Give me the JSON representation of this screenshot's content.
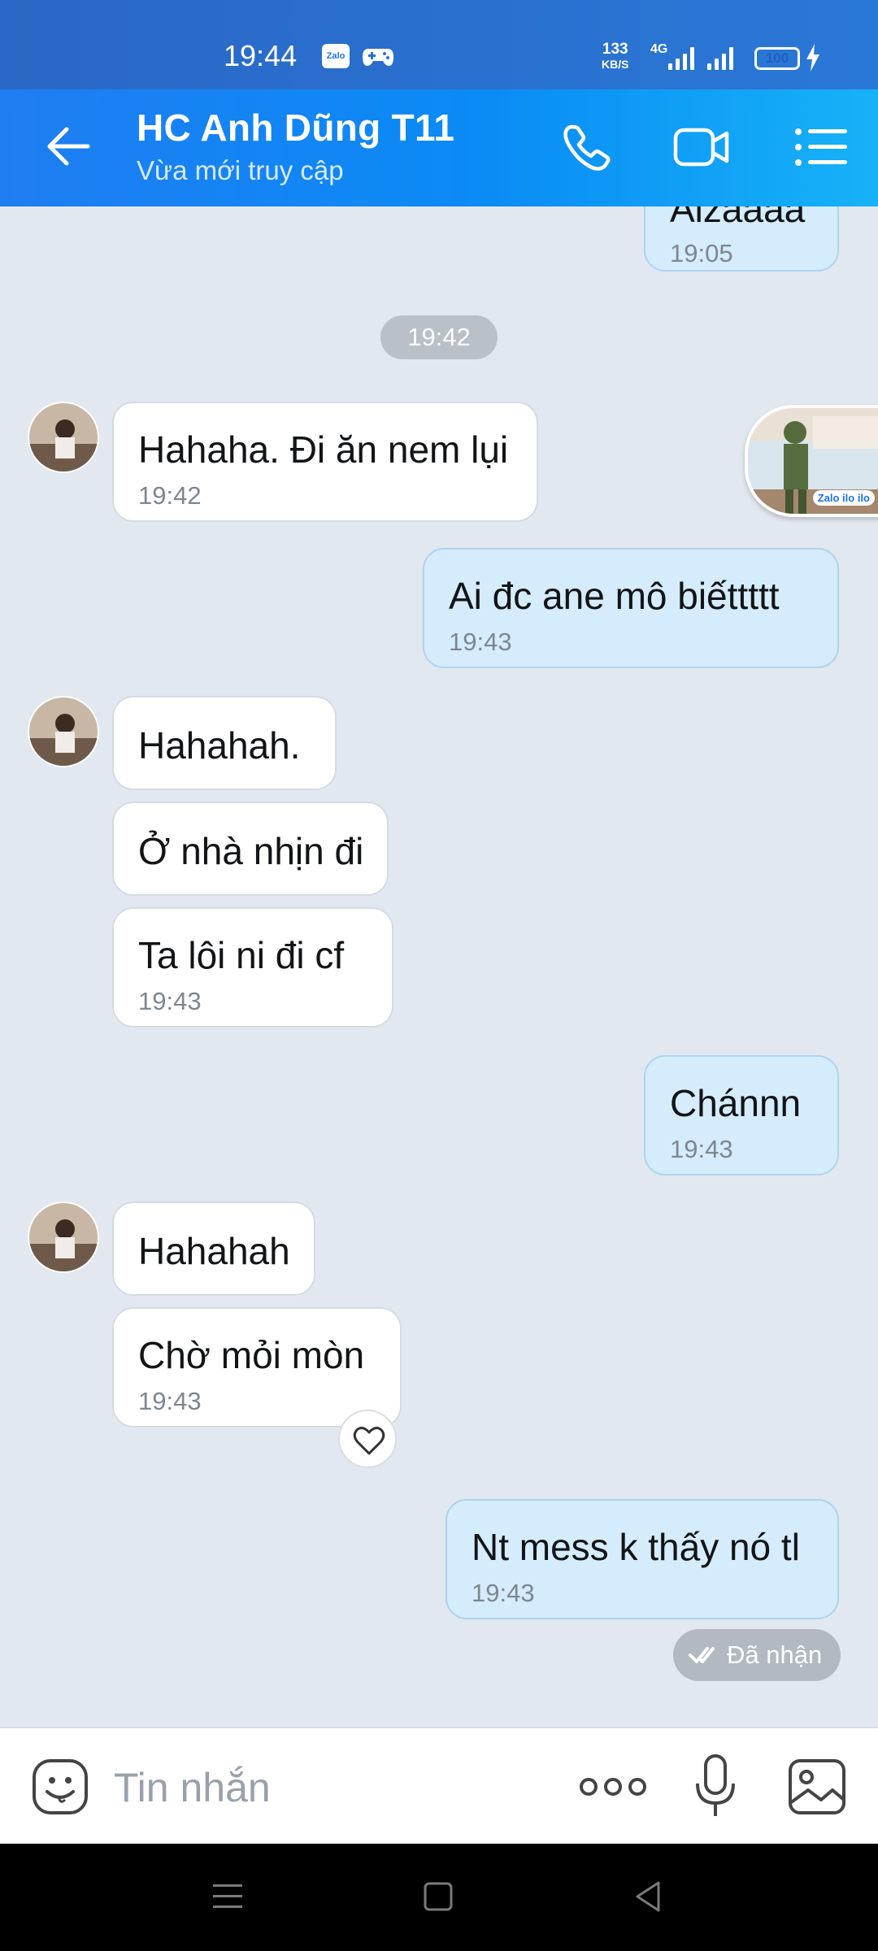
{
  "status_bar": {
    "time": "19:44",
    "zalo_badge": "Zalo",
    "net_speed_value": "133",
    "net_speed_unit": "KB/S",
    "network": "4G",
    "battery": "100"
  },
  "header": {
    "contact_name": "HC Anh Dũng T11",
    "status": "Vừa mới truy cập"
  },
  "chat": {
    "partial_top_message": {
      "text": "Aizaaaa",
      "time": "19:05"
    },
    "time_divider": "19:42",
    "messages": [
      {
        "dir": "in",
        "text": "Hahaha. Đi ăn nem lụi",
        "time": "19:42"
      },
      {
        "dir": "out",
        "text": "Ai đc ane mô biếttttt",
        "time": "19:43"
      },
      {
        "dir": "in",
        "text": "Hahahah."
      },
      {
        "dir": "in",
        "text": "Ở nhà nhịn đi"
      },
      {
        "dir": "in",
        "text": "Ta lôi ni đi cf",
        "time": "19:43"
      },
      {
        "dir": "out",
        "text": "Chánnn",
        "time": "19:43"
      },
      {
        "dir": "in",
        "text": "Hahahah"
      },
      {
        "dir": "in",
        "text": "Chờ mỏi mòn",
        "time": "19:43"
      },
      {
        "dir": "out",
        "text": "Nt mess k thấy nó tl",
        "time": "19:43"
      }
    ],
    "delivery_status": "Đã nhận",
    "sticker_caption": "Zalo ilo ilo"
  },
  "composer": {
    "placeholder": "Tin nhắn"
  },
  "colors": {
    "header_gradient_start": "#1f7df2",
    "header_gradient_end": "#16b2f7",
    "chat_background": "#e2e8ef",
    "bubble_out": "#d5ecfd",
    "bubble_in": "#ffffff"
  }
}
